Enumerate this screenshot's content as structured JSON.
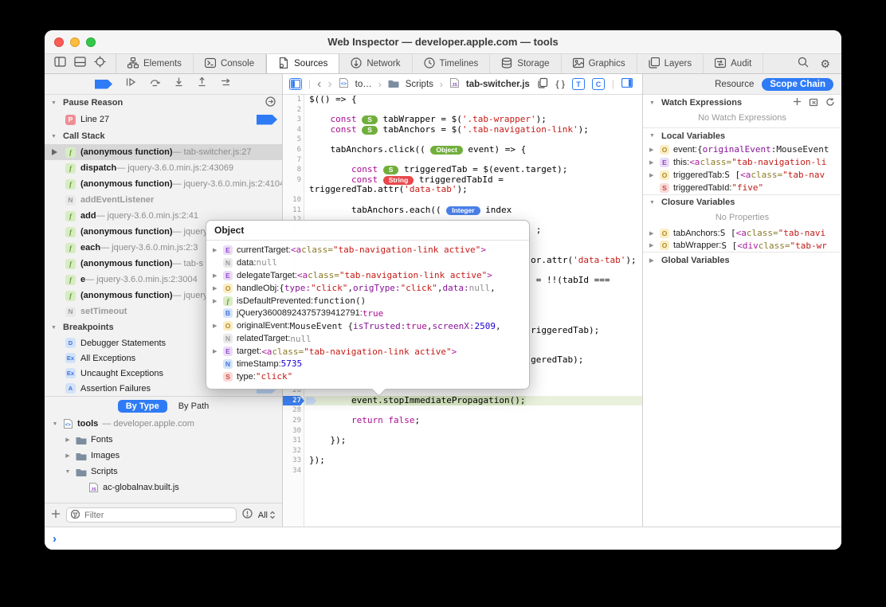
{
  "window": {
    "title": "Web Inspector — developer.apple.com — tools"
  },
  "tabs": [
    {
      "label": "Elements",
      "icon": "elements"
    },
    {
      "label": "Console",
      "icon": "console"
    },
    {
      "label": "Sources",
      "icon": "sources",
      "active": true
    },
    {
      "label": "Network",
      "icon": "network"
    },
    {
      "label": "Timelines",
      "icon": "timelines"
    },
    {
      "label": "Storage",
      "icon": "storage"
    },
    {
      "label": "Graphics",
      "icon": "graphics"
    },
    {
      "label": "Layers",
      "icon": "layers"
    },
    {
      "label": "Audit",
      "icon": "audit"
    }
  ],
  "breadcrumb": {
    "file_short": "to…",
    "folder": "Scripts",
    "file": "tab-switcher.js",
    "t_badge": "T",
    "c_badge": "C"
  },
  "right_nav": {
    "resource": "Resource",
    "scope_chain": "Scope Chain"
  },
  "sidebar": {
    "pause_reason": {
      "title": "Pause Reason",
      "badge": "P",
      "line_label": "Line 27"
    },
    "call_stack": {
      "title": "Call Stack",
      "frames": [
        {
          "badge": "f",
          "name": "(anonymous function)",
          "loc": "tab-switcher.js:27",
          "selected": true
        },
        {
          "badge": "f",
          "name": "dispatch",
          "loc": "jquery-3.6.0.min.js:2:43069"
        },
        {
          "badge": "f",
          "name": "(anonymous function)",
          "loc": "jquery-3.6.0.min.js:2:4104"
        },
        {
          "badge": "n",
          "name": "addEventListener",
          "loc": "",
          "native": true
        },
        {
          "badge": "f",
          "name": "add",
          "loc": "jquery-3.6.0.min.js:2:41"
        },
        {
          "badge": "f",
          "name": "(anonymous function)",
          "loc": "jquery"
        },
        {
          "badge": "f",
          "name": "each",
          "loc": "jquery-3.6.0.min.js:2:3"
        },
        {
          "badge": "f",
          "name": "(anonymous function)",
          "loc": "tab-s"
        },
        {
          "badge": "f",
          "name": "e",
          "loc": "jquery-3.6.0.min.js:2:3004"
        },
        {
          "badge": "f",
          "name": "(anonymous function)",
          "loc": "jquery"
        },
        {
          "badge": "n",
          "name": "setTimeout",
          "loc": "",
          "native": true
        }
      ]
    },
    "breakpoints": {
      "title": "Breakpoints",
      "items": [
        {
          "badge": "D",
          "label": "Debugger Statements"
        },
        {
          "badge": "Ex",
          "label": "All Exceptions"
        },
        {
          "badge": "Ex",
          "label": "Uncaught Exceptions"
        },
        {
          "badge": "A",
          "label": "Assertion Failures",
          "flag": true
        }
      ],
      "by_type": "By Type",
      "by_path": "By Path"
    },
    "resources": [
      {
        "dis": "▼",
        "icon": "doccode",
        "label": "tools",
        "sub": " — developer.apple.com",
        "indent": 0,
        "bold": true
      },
      {
        "dis": "▶",
        "icon": "folder",
        "label": "Fonts",
        "sub": "",
        "indent": 1
      },
      {
        "dis": "▶",
        "icon": "folder",
        "label": "Images",
        "sub": "",
        "indent": 1
      },
      {
        "dis": "▼",
        "icon": "folder",
        "label": "Scripts",
        "sub": "",
        "indent": 1
      },
      {
        "dis": "",
        "icon": "js",
        "label": "ac-globalnav.built.js",
        "sub": "",
        "indent": 2
      }
    ],
    "filter": {
      "placeholder": "Filter",
      "all_label": "All"
    }
  },
  "popover": {
    "title": "Object",
    "rows": [
      {
        "tri": true,
        "b": "e",
        "bl": "E",
        "t": [
          {
            "t": "currentTarget: "
          },
          {
            "t": "<a ",
            "c": "tag m"
          },
          {
            "t": "class=",
            "c": "attr m"
          },
          {
            "t": "\"tab-navigation-link active\"",
            "c": "str m"
          },
          {
            "t": ">",
            "c": "tag m"
          }
        ]
      },
      {
        "tri": false,
        "b": "ng",
        "bl": "N",
        "t": [
          {
            "t": "data: "
          },
          {
            "t": "null",
            "c": "gry m"
          }
        ]
      },
      {
        "tri": true,
        "b": "e",
        "bl": "E",
        "t": [
          {
            "t": "delegateTarget: "
          },
          {
            "t": "<a ",
            "c": "tag m"
          },
          {
            "t": "class=",
            "c": "attr m"
          },
          {
            "t": "\"tab-navigation-link active\"",
            "c": "str m"
          },
          {
            "t": ">",
            "c": "tag m"
          }
        ]
      },
      {
        "tri": true,
        "b": "o",
        "bl": "O",
        "t": [
          {
            "t": "handleObj: "
          },
          {
            "t": "{",
            "c": "m"
          },
          {
            "t": "type:",
            "c": "key m"
          },
          {
            "t": " ",
            "c": "m"
          },
          {
            "t": "\"click\"",
            "c": "str m"
          },
          {
            "t": ", ",
            "c": "m"
          },
          {
            "t": "origType:",
            "c": "key m"
          },
          {
            "t": " ",
            "c": "m"
          },
          {
            "t": "\"click\"",
            "c": "str m"
          },
          {
            "t": ", ",
            "c": "m"
          },
          {
            "t": "data:",
            "c": "key m"
          },
          {
            "t": " ",
            "c": "m"
          },
          {
            "t": "null",
            "c": "gry m"
          },
          {
            "t": ",",
            "c": "m"
          }
        ]
      },
      {
        "tri": true,
        "b": "f",
        "bl": "f",
        "t": [
          {
            "t": "isDefaultPrevented: "
          },
          {
            "t": "function()",
            "c": "m"
          }
        ]
      },
      {
        "tri": false,
        "b": "b",
        "bl": "B",
        "t": [
          {
            "t": "jQuery36008924375739412791: "
          },
          {
            "t": "true",
            "c": "bool m"
          }
        ]
      },
      {
        "tri": true,
        "b": "o",
        "bl": "O",
        "t": [
          {
            "t": "originalEvent: "
          },
          {
            "t": "MouseEvent {",
            "c": "m"
          },
          {
            "t": "isTrusted:",
            "c": "key m"
          },
          {
            "t": " ",
            "c": "m"
          },
          {
            "t": "true",
            "c": "bool m"
          },
          {
            "t": ", ",
            "c": "m"
          },
          {
            "t": "screenX:",
            "c": "key m"
          },
          {
            "t": " ",
            "c": "m"
          },
          {
            "t": "2509",
            "c": "num m"
          },
          {
            "t": ",",
            "c": "m"
          }
        ]
      },
      {
        "tri": false,
        "b": "ng",
        "bl": "N",
        "t": [
          {
            "t": "relatedTarget: "
          },
          {
            "t": "null",
            "c": "gry m"
          }
        ]
      },
      {
        "tri": true,
        "b": "e",
        "bl": "E",
        "t": [
          {
            "t": "target: "
          },
          {
            "t": "<a ",
            "c": "tag m"
          },
          {
            "t": "class=",
            "c": "attr m"
          },
          {
            "t": "\"tab-navigation-link active\"",
            "c": "str m"
          },
          {
            "t": ">",
            "c": "tag m"
          }
        ]
      },
      {
        "tri": false,
        "b": "nb",
        "bl": "N",
        "t": [
          {
            "t": "timeStamp: "
          },
          {
            "t": "5735",
            "c": "num m"
          }
        ]
      },
      {
        "tri": false,
        "b": "s",
        "bl": "S",
        "t": [
          {
            "t": "type: "
          },
          {
            "t": "\"click\"",
            "c": "str m"
          }
        ]
      }
    ]
  },
  "code": {
    "rows": [
      {
        "n": "1",
        "t": [
          {
            "t": "$(() => {"
          }
        ]
      },
      {
        "n": "2",
        "t": []
      },
      {
        "n": "3",
        "t": [
          {
            "t": "    "
          },
          {
            "t": "const",
            "c": "kw"
          },
          {
            "t": " "
          },
          {
            "t": "S",
            "c": "pill pg"
          },
          {
            "t": " tabWrapper = $("
          },
          {
            "t": "'.tab-wrapper'",
            "c": "str"
          },
          {
            "t": ");"
          }
        ]
      },
      {
        "n": "4",
        "t": [
          {
            "t": "    "
          },
          {
            "t": "const",
            "c": "kw"
          },
          {
            "t": " "
          },
          {
            "t": "S",
            "c": "pill pg"
          },
          {
            "t": " tabAnchors = $("
          },
          {
            "t": "'.tab-navigation-link'",
            "c": "str"
          },
          {
            "t": ");"
          }
        ]
      },
      {
        "n": "5",
        "t": []
      },
      {
        "n": "6",
        "t": [
          {
            "t": "    tabAnchors.click(( "
          },
          {
            "t": "Object",
            "c": "pill pg"
          },
          {
            "t": " event) => {"
          }
        ]
      },
      {
        "n": "7",
        "t": []
      },
      {
        "n": "8",
        "t": [
          {
            "t": "        "
          },
          {
            "t": "const",
            "c": "kw"
          },
          {
            "t": " "
          },
          {
            "t": "S",
            "c": "pill pg"
          },
          {
            "t": " triggeredTab = $(event.target);"
          }
        ]
      },
      {
        "n": "9",
        "t": [
          {
            "t": "        "
          },
          {
            "t": "const",
            "c": "kw"
          },
          {
            "t": " "
          },
          {
            "t": "String",
            "c": "pill pr"
          },
          {
            "t": " triggeredTabId ="
          }
        ]
      },
      {
        "n": "",
        "t": [
          {
            "t": "triggeredTab.attr("
          },
          {
            "t": "'data-tab'",
            "c": "str"
          },
          {
            "t": ");"
          }
        ]
      },
      {
        "n": "10",
        "t": []
      },
      {
        "n": "11",
        "t": [
          {
            "t": "        tabAnchors.each(( "
          },
          {
            "t": "Integer",
            "c": "pill pb"
          },
          {
            "t": " index"
          }
        ]
      },
      {
        "n": "12",
        "t": []
      },
      {
        "n": "13",
        "t": [
          {
            "t": "                                           ;"
          }
        ]
      },
      {
        "n": "",
        "t": []
      },
      {
        "n": "14",
        "t": []
      },
      {
        "n": "15",
        "t": [
          {
            "t": "                                          or.attr("
          },
          {
            "t": "'data-tab'",
            "c": "str"
          },
          {
            "t": ");"
          }
        ]
      },
      {
        "n": "16",
        "t": []
      },
      {
        "n": "17",
        "t": [
          {
            "t": "                                           = !!(tabId ==="
          }
        ]
      },
      {
        "n": "",
        "t": []
      },
      {
        "n": "18",
        "t": []
      },
      {
        "n": "19",
        "t": []
      },
      {
        "n": "20",
        "t": []
      },
      {
        "n": "21",
        "t": [
          {
            "t": "                                          riggeredTab);"
          }
        ]
      },
      {
        "n": "22",
        "t": []
      },
      {
        "n": "23",
        "t": []
      },
      {
        "n": "24",
        "t": [
          {
            "t": "                                          geredTab);"
          }
        ]
      },
      {
        "n": "",
        "t": []
      },
      {
        "n": "25",
        "t": []
      },
      {
        "n": "26",
        "t": []
      },
      {
        "n": "27",
        "cls": "hl",
        "t": [
          {
            "t": "        "
          },
          {
            "t": "event.stopImmediatePropagation();",
            "c": "hlseg"
          }
        ]
      },
      {
        "n": "28",
        "t": []
      },
      {
        "n": "29",
        "t": [
          {
            "t": "        "
          },
          {
            "t": "return",
            "c": "kw"
          },
          {
            "t": " "
          },
          {
            "t": "false",
            "c": "kw"
          },
          {
            "t": ";"
          }
        ]
      },
      {
        "n": "30",
        "t": []
      },
      {
        "n": "31",
        "t": [
          {
            "t": "    });"
          }
        ]
      },
      {
        "n": "32",
        "t": []
      },
      {
        "n": "33",
        "t": [
          {
            "t": "});"
          }
        ]
      },
      {
        "n": "34",
        "t": []
      }
    ]
  },
  "scope": {
    "watch": {
      "title": "Watch Expressions",
      "empty": "No Watch Expressions"
    },
    "local": {
      "title": "Local Variables",
      "rows": [
        {
          "tri": true,
          "b": "o",
          "bl": "O",
          "t": [
            {
              "t": "event: "
            },
            {
              "t": "{",
              "c": "m"
            },
            {
              "t": "originalEvent",
              "c": "key m"
            },
            {
              "t": ": ",
              "c": "m"
            },
            {
              "t": "MouseEvent",
              "c": "m"
            }
          ]
        },
        {
          "tri": true,
          "b": "e",
          "bl": "E",
          "t": [
            {
              "t": "this: "
            },
            {
              "t": "<a ",
              "c": "tag m"
            },
            {
              "t": "class=",
              "c": "attr m"
            },
            {
              "t": "\"tab-navigation-li",
              "c": "str m"
            }
          ]
        },
        {
          "tri": true,
          "b": "o",
          "bl": "O",
          "t": [
            {
              "t": "triggeredTab: "
            },
            {
              "t": "S [",
              "c": "m"
            },
            {
              "t": "<a ",
              "c": "tag m"
            },
            {
              "t": "class=",
              "c": "attr m"
            },
            {
              "t": "\"tab-nav",
              "c": "str m"
            }
          ]
        },
        {
          "tri": false,
          "b": "s",
          "bl": "S",
          "t": [
            {
              "t": "triggeredTabId: "
            },
            {
              "t": "\"five\"",
              "c": "str m"
            }
          ]
        }
      ]
    },
    "closure": {
      "title": "Closure Variables",
      "empty": "No Properties",
      "rows": [
        {
          "tri": true,
          "b": "o",
          "bl": "O",
          "t": [
            {
              "t": "tabAnchors: "
            },
            {
              "t": "S [",
              "c": "m"
            },
            {
              "t": "<a ",
              "c": "tag m"
            },
            {
              "t": "class=",
              "c": "attr m"
            },
            {
              "t": "\"tab-navi",
              "c": "str m"
            }
          ]
        },
        {
          "tri": true,
          "b": "o",
          "bl": "O",
          "t": [
            {
              "t": "tabWrapper: "
            },
            {
              "t": "S [",
              "c": "m"
            },
            {
              "t": "<div ",
              "c": "tag m"
            },
            {
              "t": "class=",
              "c": "attr m"
            },
            {
              "t": "\"tab-wr",
              "c": "str m"
            }
          ]
        }
      ]
    },
    "global": {
      "title": "Global Variables"
    }
  },
  "console": {
    "prompt": "›"
  }
}
